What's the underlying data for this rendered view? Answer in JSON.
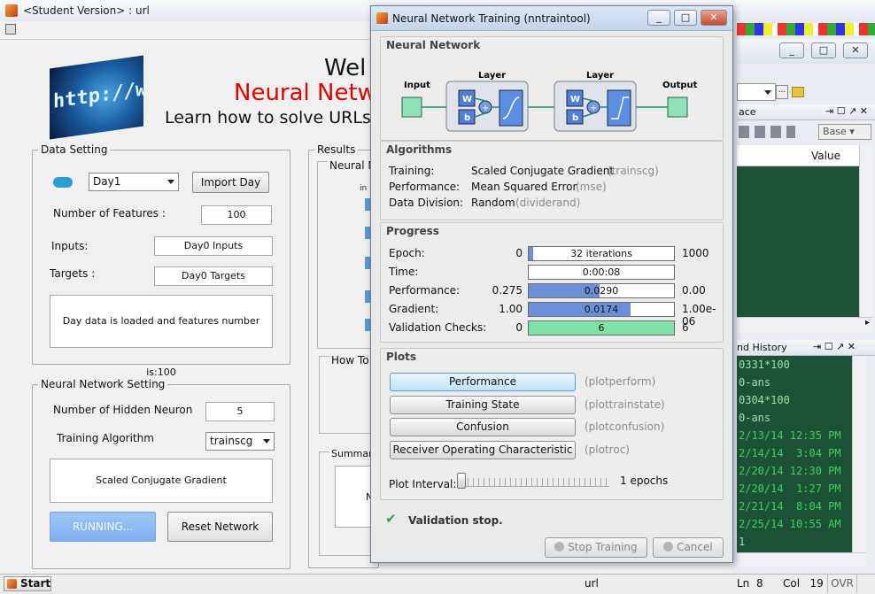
{
  "background_window": {
    "title": "<Student Version> : url",
    "welcome_text": "Wel",
    "nn_title_text": "Neural Netw",
    "learn_text": "Learn how to solve URLs",
    "logo_text": "http://ww",
    "data_setting": {
      "legend": "Data Setting",
      "day_select": "Day1",
      "import_button": "Import Day",
      "features_label": "Number of Features :",
      "features_value": "100",
      "inputs_label": "Inputs:",
      "inputs_value": "Day0 Inputs",
      "targets_label": "Targets :",
      "targets_value": "Day0 Targets",
      "message": "Day data is loaded and features number is:100"
    },
    "nn_setting": {
      "legend": "Neural Network Setting",
      "hidden_label": "Number of Hidden Neuron",
      "hidden_value": "5",
      "algo_label": "Training Algorithm",
      "algo_select": "trainscg",
      "algo_desc": "Scaled Conjugate Gradient",
      "running_button": "RUNNING...",
      "reset_button": "Reset Network"
    },
    "results": {
      "legend": "Results",
      "sub1": "Neural N",
      "sub1_small": "in",
      "sub2": "How To",
      "sub3": "Summary",
      "sub3_text": "N"
    }
  },
  "right_desktop": {
    "workspace_label": "ace",
    "base_select": "Base",
    "value_header": "Value",
    "history_label": "nd History",
    "history_lines": [
      "0331*100",
      "0-ans",
      "0304*100",
      "0-ans",
      "2/13/14 12:35 PM",
      "2/14/14  3:04 PM",
      "2/20/14 12:30 PM",
      "2/20/14  1:27 PM",
      "2/21/14  8:04 PM",
      "2/25/14 10:55 AM",
      "1"
    ]
  },
  "statusbar": {
    "start": "Start",
    "file": "url",
    "ln_label": "Ln",
    "ln": "8",
    "col_label": "Col",
    "col": "19",
    "ovr": "OVR"
  },
  "dialog": {
    "title": "Neural Network Training (nntraintool)",
    "network": {
      "section": "Neural Network",
      "input": "Input",
      "layer1": "Layer",
      "layer2": "Layer",
      "output": "Output",
      "w": "W",
      "b": "b",
      "plus": "+"
    },
    "algorithms": {
      "section": "Algorithms",
      "rows": [
        {
          "label": "Training:",
          "value": "Scaled Conjugate Gradient",
          "fn": "(trainscg)"
        },
        {
          "label": "Performance:",
          "value": "Mean Squared Error",
          "fn": "(mse)"
        },
        {
          "label": "Data Division:",
          "value": "Random",
          "fn": "(dividerand)"
        }
      ]
    },
    "progress": {
      "section": "Progress",
      "rows": [
        {
          "label": "Epoch:",
          "start": "0",
          "text": "32 iterations",
          "end": "1000",
          "fill": 0.032
        },
        {
          "label": "Time:",
          "start": "",
          "text": "0:00:08",
          "end": "",
          "fill": 0
        },
        {
          "label": "Performance:",
          "start": "0.275",
          "text": "0.0290",
          "end": "0.00",
          "fill": 0.49
        },
        {
          "label": "Gradient:",
          "start": "1.00",
          "text": "0.0174",
          "end": "1.00e-06",
          "fill": 0.7
        },
        {
          "label": "Validation Checks:",
          "start": "0",
          "text": "6",
          "end": "6",
          "fill": 1.0
        }
      ]
    },
    "plots": {
      "section": "Plots",
      "buttons": [
        {
          "label": "Performance",
          "fn": "(plotperform)"
        },
        {
          "label": "Training State",
          "fn": "(plottrainstate)"
        },
        {
          "label": "Confusion",
          "fn": "(plotconfusion)"
        },
        {
          "label": "Receiver Operating Characteristic",
          "fn": "(plotroc)"
        }
      ],
      "interval_label": "Plot Interval:",
      "interval_value": "1 epochs"
    },
    "status": "Validation stop.",
    "stop_button": "Stop Training",
    "cancel_button": "Cancel"
  },
  "colors": {
    "progress_fill": "#6c8fd8",
    "validation_fill": "#7fe0a8",
    "title_red": "#e00000",
    "command_bg": "#1e5238"
  }
}
